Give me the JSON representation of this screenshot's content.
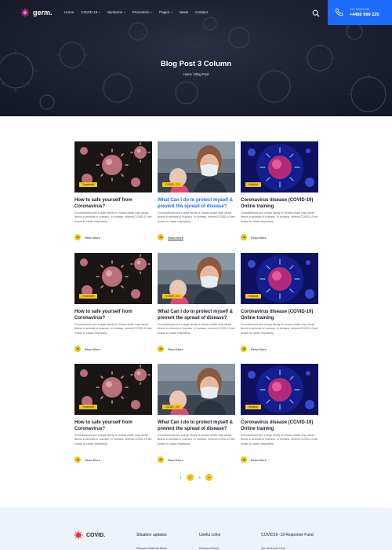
{
  "header": {
    "logo_text": "germ.",
    "nav": [
      {
        "label": "Home",
        "dropdown": false
      },
      {
        "label": "COVID-19",
        "dropdown": true
      },
      {
        "label": "Symtoms",
        "dropdown": true
      },
      {
        "label": "Prevention",
        "dropdown": true
      },
      {
        "label": "Pages",
        "dropdown": true
      },
      {
        "label": "News",
        "dropdown": false
      },
      {
        "label": "Contact",
        "dropdown": false
      }
    ],
    "helpline_label": "24/7 HELPLINE",
    "helpline_number": "+4480 999 225",
    "accent_color": "#1d6bfe"
  },
  "hero": {
    "title": "Blog Post 3 Column",
    "breadcrumb": "Home / Blog Post"
  },
  "posts": [
    {
      "badge": "Treatment",
      "image": "virus-cells-dark",
      "title": "How to safe yourself from Coronavirus?",
      "title_active": false,
      "excerpt": "Coronaviruses are a large family of viruses which may cause illness in animals or humans. In humans, several COVID-19 are known to cause respiratory.",
      "read_more": "Read More",
      "read_more_underlined": false
    },
    {
      "badge": "COVID - 19",
      "image": "masked-woman-child",
      "title": "What Can I do to protect myself & prevent the spread of disease?",
      "title_active": true,
      "excerpt": "Coronaviruses are a large family of viruses which may cause illness in animals or humans. In humans, several COVID-19 are known to cause respiratory.",
      "read_more": "Read More",
      "read_more_underlined": true
    },
    {
      "badge": "Medical",
      "image": "virus-glow-blue",
      "title": "Coronavirus disease (COVID-19) Online training",
      "title_active": false,
      "excerpt": "Coronaviruses are a large family of viruses which may cause illness in animals or humans. In humans, several COVID-19 are known to cause respiratory.",
      "read_more": "Read More",
      "read_more_underlined": false
    },
    {
      "badge": "Treatment",
      "image": "virus-cells-dark",
      "title": "How to safe yourself from Coronavirus?",
      "title_active": false,
      "excerpt": "Coronaviruses are a large family of viruses which may cause illness in animals or humans. In humans, several COVID-19 are known to cause respiratory.",
      "read_more": "Read More",
      "read_more_underlined": false
    },
    {
      "badge": "COVID - 19",
      "image": "masked-woman-child",
      "title": "What Can I do to protect myself & prevent the spread of disease?",
      "title_active": false,
      "excerpt": "Coronaviruses are a large family of viruses which may cause illness in animals or humans. In humans, several COVID-19 are known to cause respiratory.",
      "read_more": "Read More",
      "read_more_underlined": false
    },
    {
      "badge": "Medical",
      "image": "virus-glow-blue",
      "title": "Coronavirus disease (COVID-19) Online training",
      "title_active": false,
      "excerpt": "Coronaviruses are a large family of viruses which may cause illness in animals or humans. In humans, several COVID-19 are known to cause respiratory.",
      "read_more": "Read More",
      "read_more_underlined": false
    },
    {
      "badge": "Treatment",
      "image": "virus-cells-dark",
      "title": "How to safe yourself from Coronavirus?",
      "title_active": false,
      "excerpt": "Coronaviruses are a large family of viruses which may cause illness in animals or humans. In humans, several COVID-19 are known to cause respiratory.",
      "read_more": "Read More",
      "read_more_underlined": false
    },
    {
      "badge": "COVID - 19",
      "image": "masked-woman-child",
      "title": "What Can I do to protect myself & prevent the spread of disease?",
      "title_active": false,
      "excerpt": "Coronaviruses are a large family of viruses which may cause illness in animals or humans. In humans, several COVID-19 are known to cause respiratory.",
      "read_more": "Read More",
      "read_more_underlined": false
    },
    {
      "badge": "Medical",
      "image": "virus-glow-blue",
      "title": "Coronavirus disease (COVID-19) Online training",
      "title_active": false,
      "excerpt": "Coronaviruses are a large family of viruses which may cause illness in animals or humans. In humans, several COVID-19 are known to cause respiratory.",
      "read_more": "Read More",
      "read_more_underlined": false
    }
  ],
  "pagination": {
    "pages": [
      "1",
      "2",
      "3"
    ],
    "active": "2",
    "next_symbol": "»"
  },
  "footer": {
    "logo_text": "COVID.",
    "col_situation": "Situation updates",
    "col_links": "Useful Links",
    "col_fund": "COVID19 -19 Response Fund",
    "situation_sub": "Disease Outbreak News",
    "links_sub": "Directors Board",
    "fund_sub": "We need your Help"
  },
  "colors": {
    "yellow": "#f6c318",
    "blue": "#1d6bfe",
    "dark": "#1a1d27",
    "footer_bg": "#eef2fa"
  }
}
